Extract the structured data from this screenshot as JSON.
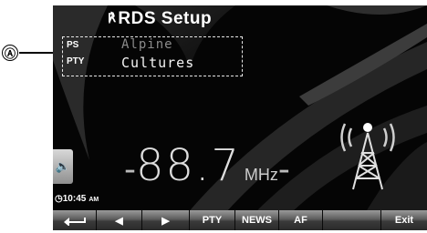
{
  "callout": {
    "letter": "Ⓐ"
  },
  "header": {
    "title": "RDS Setup",
    "title_icon": "rds-icon"
  },
  "rds_info": {
    "ps_label": "PS",
    "ps_value": "Alpine",
    "pty_label": "PTY",
    "pty_value": "Cultures"
  },
  "tuner": {
    "frequency": "88.7",
    "unit": "MHz",
    "dash_left": "-",
    "dash_right": "-"
  },
  "clock": {
    "time": "10:45",
    "ampm": "AM"
  },
  "volume": {
    "icon": "speaker-icon"
  },
  "toolbar": {
    "back_icon": "return-icon",
    "prev_icon": "left-arrow-icon",
    "next_icon": "right-arrow-icon",
    "pty_label": "PTY",
    "news_label": "NEWS",
    "af_label": "AF",
    "exit_label": "Exit"
  },
  "colors": {
    "screen_bg": "#050505",
    "text": "#ffffff",
    "ps_value": "#8a8a8a"
  }
}
